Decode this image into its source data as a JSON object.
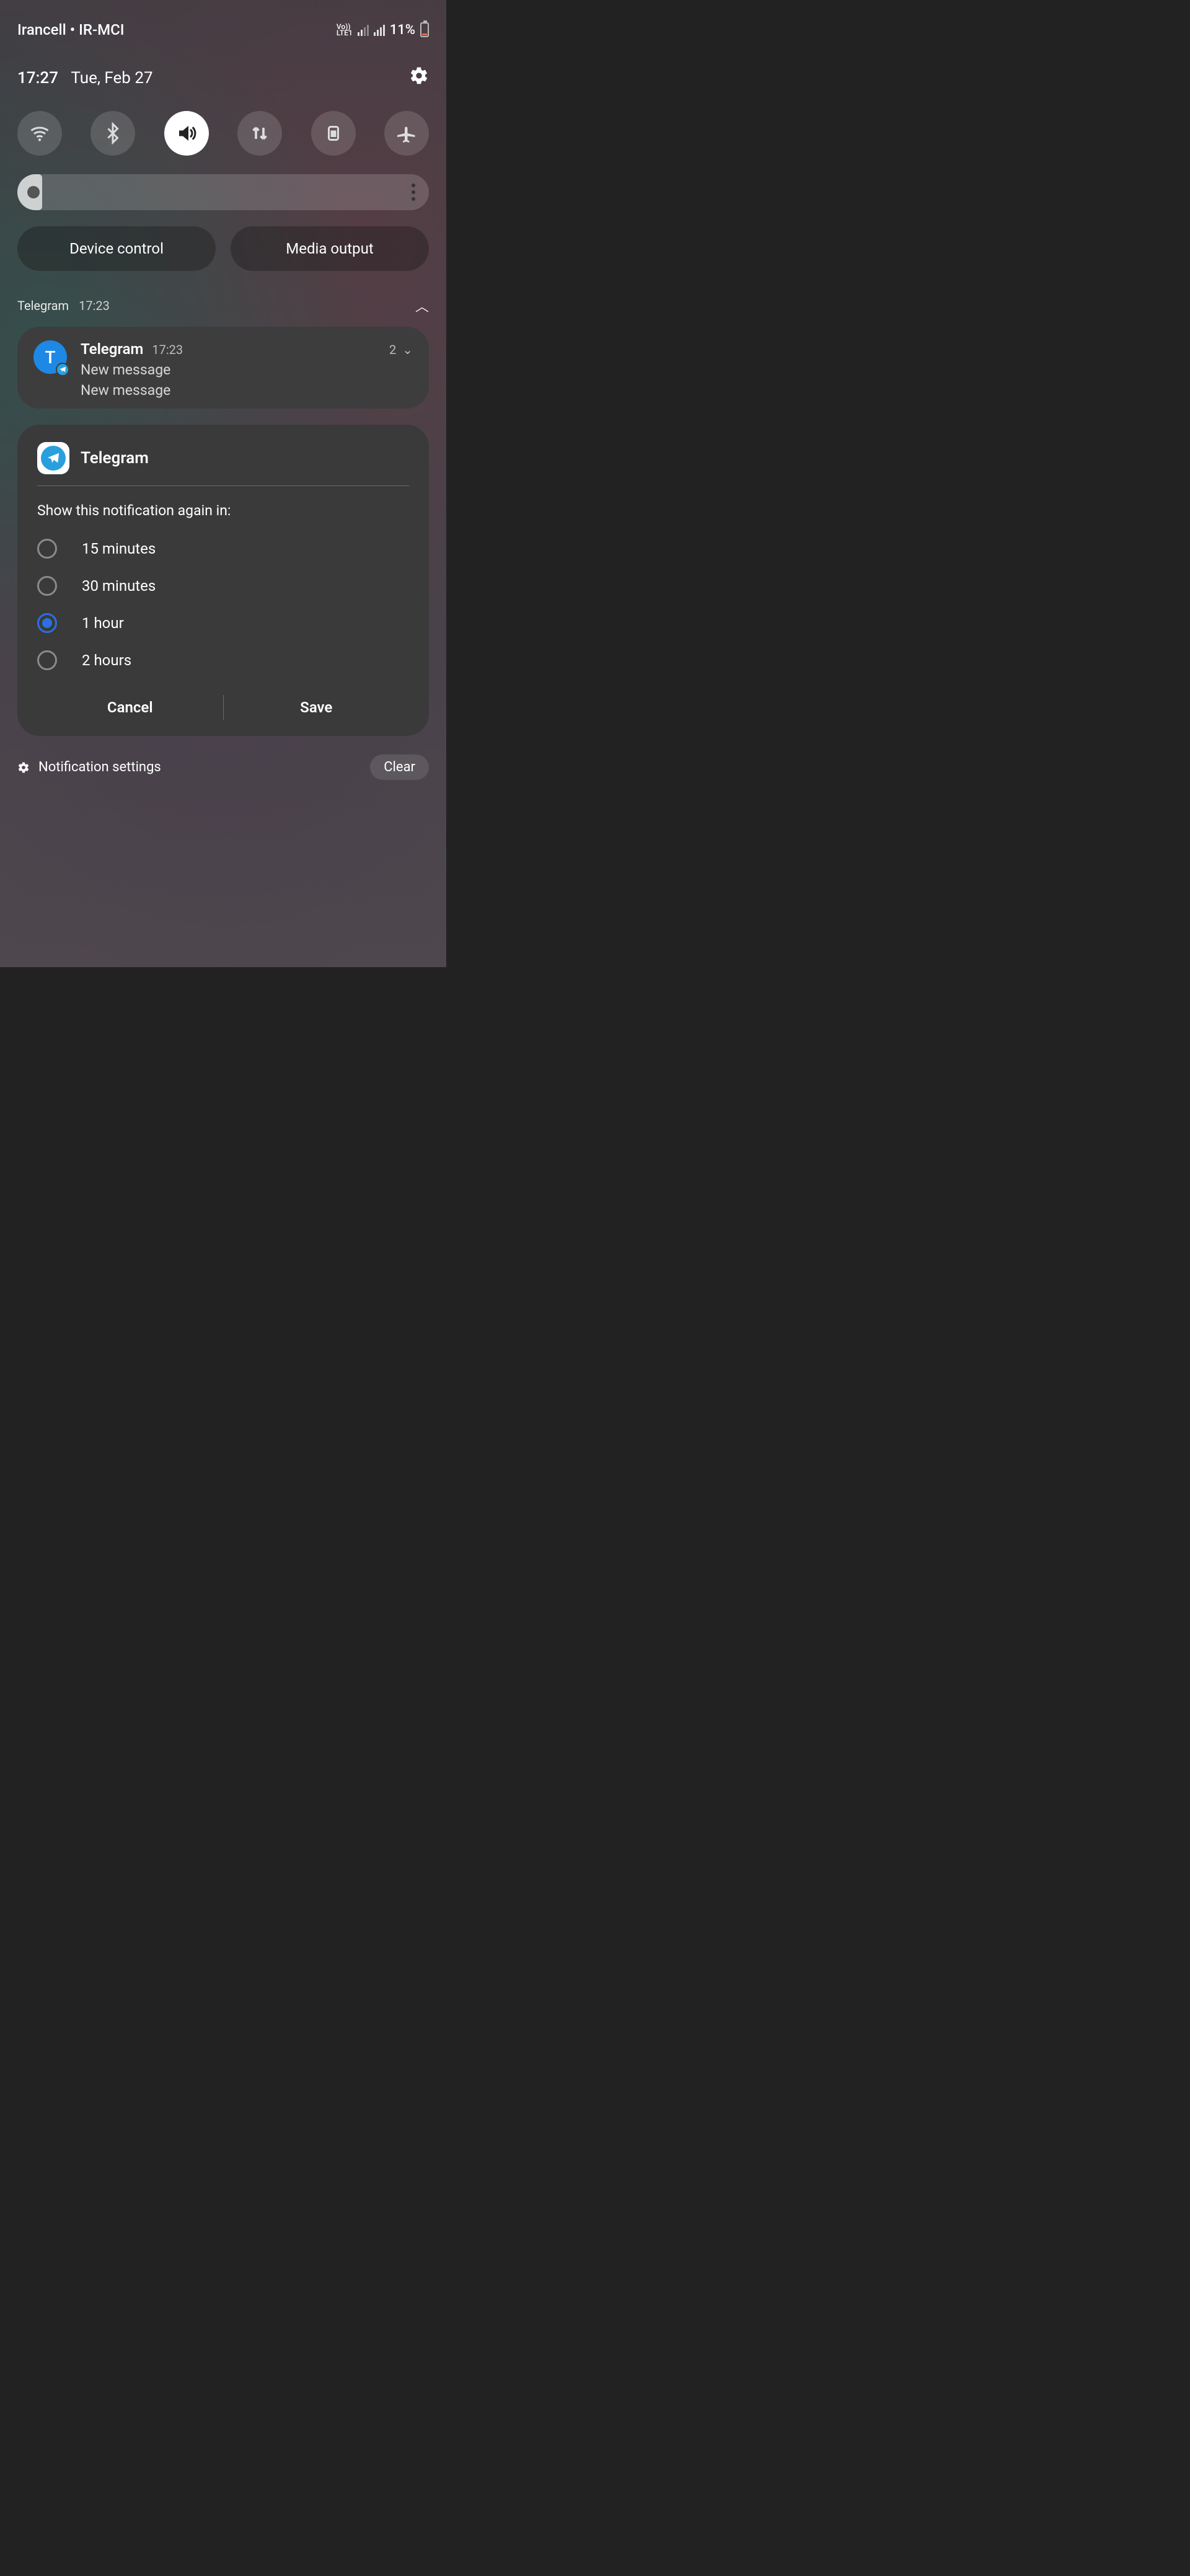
{
  "statusbar": {
    "carriers": "Irancell • IR-MCI",
    "net_label_top": "Vo))",
    "net_label_bottom": "LTE1",
    "battery_pct": "11%"
  },
  "timerow": {
    "time": "17:27",
    "date": "Tue, Feb 27"
  },
  "quick_settings": {
    "items": [
      {
        "name": "wifi",
        "active": false
      },
      {
        "name": "bluetooth",
        "active": false
      },
      {
        "name": "sound",
        "active": true
      },
      {
        "name": "mobile-data",
        "active": false
      },
      {
        "name": "rotation-lock",
        "active": false
      },
      {
        "name": "airplane",
        "active": false
      }
    ]
  },
  "chips": {
    "device_control": "Device control",
    "media_output": "Media output"
  },
  "group_header": {
    "app": "Telegram",
    "time": "17:23"
  },
  "notification": {
    "avatar_letter": "T",
    "title": "Telegram",
    "time": "17:23",
    "count": "2",
    "line1": "New message",
    "line2": "New message"
  },
  "snooze": {
    "app": "Telegram",
    "prompt": "Show this notification again in:",
    "options": [
      {
        "label": "15 minutes",
        "selected": false
      },
      {
        "label": "30 minutes",
        "selected": false
      },
      {
        "label": "1 hour",
        "selected": true
      },
      {
        "label": "2 hours",
        "selected": false
      }
    ],
    "cancel": "Cancel",
    "save": "Save"
  },
  "footer": {
    "notification_settings": "Notification settings",
    "clear": "Clear"
  }
}
